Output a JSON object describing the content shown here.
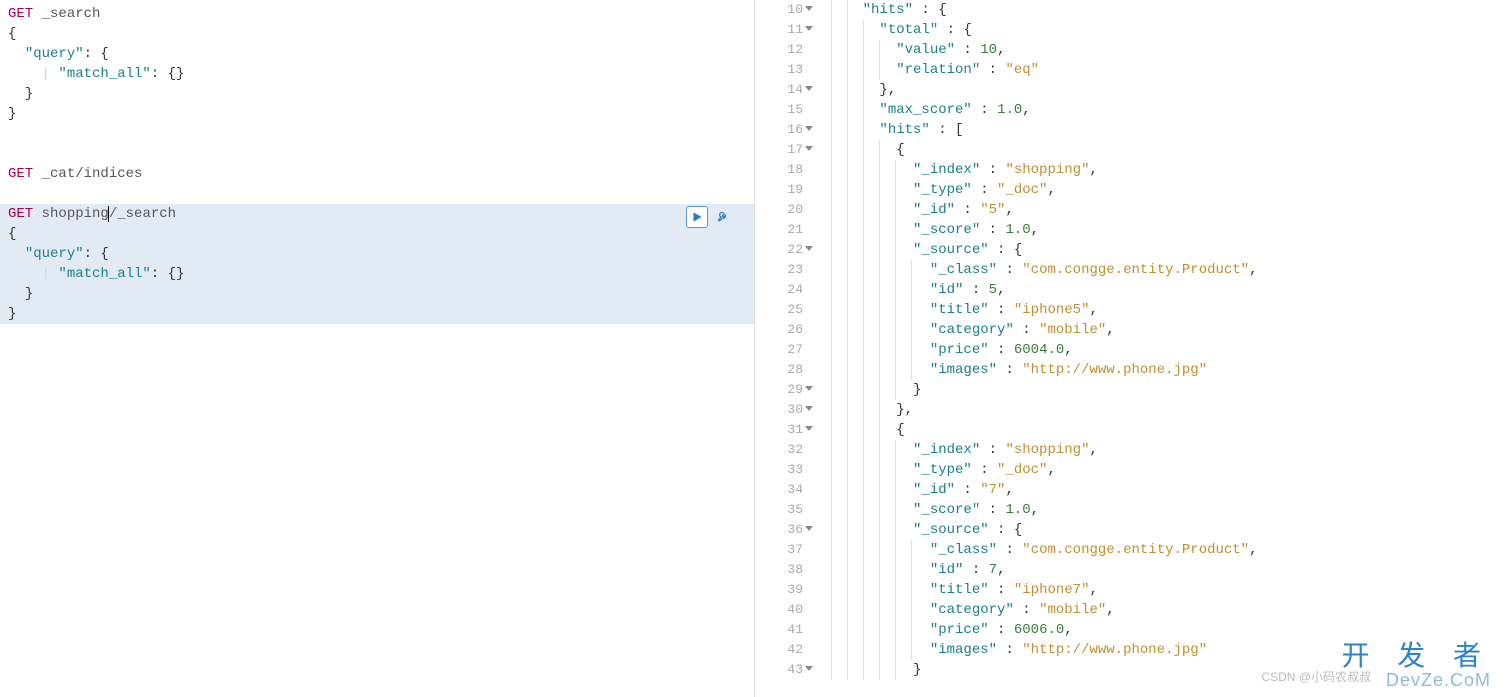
{
  "left": {
    "blocks": [
      {
        "active": false,
        "lines": [
          {
            "indent": 0,
            "tokens": [
              {
                "t": "method",
                "v": "GET"
              },
              {
                "t": "space",
                "v": " "
              },
              {
                "t": "path",
                "v": "_search"
              }
            ]
          },
          {
            "indent": 0,
            "tokens": [
              {
                "t": "punc",
                "v": "{"
              }
            ]
          },
          {
            "indent": 1,
            "tokens": [
              {
                "t": "key",
                "v": "\"query\""
              },
              {
                "t": "punc",
                "v": ": {"
              }
            ]
          },
          {
            "indent": 2,
            "tokens": [
              {
                "t": "key",
                "v": "\"match_all\""
              },
              {
                "t": "punc",
                "v": ": {}"
              }
            ]
          },
          {
            "indent": 1,
            "tokens": [
              {
                "t": "punc",
                "v": "}"
              }
            ]
          },
          {
            "indent": 0,
            "tokens": [
              {
                "t": "punc",
                "v": "}"
              }
            ]
          }
        ]
      },
      {
        "spacer": true,
        "lines": 2
      },
      {
        "active": false,
        "lines": [
          {
            "indent": 0,
            "tokens": [
              {
                "t": "method",
                "v": "GET"
              },
              {
                "t": "space",
                "v": " "
              },
              {
                "t": "path",
                "v": "_cat/indices"
              }
            ]
          }
        ]
      },
      {
        "spacer": true,
        "lines": 1
      },
      {
        "active": true,
        "lines": [
          {
            "indent": 0,
            "tokens": [
              {
                "t": "method",
                "v": "GET"
              },
              {
                "t": "space",
                "v": " "
              },
              {
                "t": "path",
                "v": "shopping"
              },
              {
                "t": "cursor",
                "v": ""
              },
              {
                "t": "path",
                "v": "/_search"
              }
            ]
          },
          {
            "indent": 0,
            "tokens": [
              {
                "t": "punc",
                "v": "{"
              }
            ]
          },
          {
            "indent": 1,
            "tokens": [
              {
                "t": "key",
                "v": "\"query\""
              },
              {
                "t": "punc",
                "v": ": {"
              }
            ]
          },
          {
            "indent": 2,
            "tokens": [
              {
                "t": "key",
                "v": "\"match_all\""
              },
              {
                "t": "punc",
                "v": ": {}"
              }
            ]
          },
          {
            "indent": 1,
            "tokens": [
              {
                "t": "punc",
                "v": "}"
              }
            ]
          },
          {
            "indent": 0,
            "tokens": [
              {
                "t": "punc",
                "v": "}"
              }
            ]
          }
        ]
      }
    ]
  },
  "right": {
    "startLine": 10,
    "lines": [
      {
        "n": 10,
        "fold": true,
        "depth": 2,
        "tokens": [
          {
            "t": "key",
            "v": "\"hits\""
          },
          {
            "t": "punc",
            "v": " : {"
          }
        ]
      },
      {
        "n": 11,
        "fold": true,
        "depth": 3,
        "tokens": [
          {
            "t": "key",
            "v": "\"total\""
          },
          {
            "t": "punc",
            "v": " : {"
          }
        ]
      },
      {
        "n": 12,
        "fold": false,
        "depth": 4,
        "tokens": [
          {
            "t": "key",
            "v": "\"value\""
          },
          {
            "t": "punc",
            "v": " : "
          },
          {
            "t": "num",
            "v": "10"
          },
          {
            "t": "punc",
            "v": ","
          }
        ]
      },
      {
        "n": 13,
        "fold": false,
        "depth": 4,
        "tokens": [
          {
            "t": "key",
            "v": "\"relation\""
          },
          {
            "t": "punc",
            "v": " : "
          },
          {
            "t": "str",
            "v": "\"eq\""
          }
        ]
      },
      {
        "n": 14,
        "fold": true,
        "depth": 3,
        "tokens": [
          {
            "t": "punc",
            "v": "},"
          }
        ]
      },
      {
        "n": 15,
        "fold": false,
        "depth": 3,
        "tokens": [
          {
            "t": "key",
            "v": "\"max_score\""
          },
          {
            "t": "punc",
            "v": " : "
          },
          {
            "t": "num",
            "v": "1.0"
          },
          {
            "t": "punc",
            "v": ","
          }
        ]
      },
      {
        "n": 16,
        "fold": true,
        "depth": 3,
        "tokens": [
          {
            "t": "key",
            "v": "\"hits\""
          },
          {
            "t": "punc",
            "v": " : ["
          }
        ]
      },
      {
        "n": 17,
        "fold": true,
        "depth": 4,
        "tokens": [
          {
            "t": "punc",
            "v": "{"
          }
        ]
      },
      {
        "n": 18,
        "fold": false,
        "depth": 5,
        "tokens": [
          {
            "t": "key",
            "v": "\"_index\""
          },
          {
            "t": "punc",
            "v": " : "
          },
          {
            "t": "str",
            "v": "\"shopping\""
          },
          {
            "t": "punc",
            "v": ","
          }
        ]
      },
      {
        "n": 19,
        "fold": false,
        "depth": 5,
        "tokens": [
          {
            "t": "key",
            "v": "\"_type\""
          },
          {
            "t": "punc",
            "v": " : "
          },
          {
            "t": "str",
            "v": "\"_doc\""
          },
          {
            "t": "punc",
            "v": ","
          }
        ]
      },
      {
        "n": 20,
        "fold": false,
        "depth": 5,
        "tokens": [
          {
            "t": "key",
            "v": "\"_id\""
          },
          {
            "t": "punc",
            "v": " : "
          },
          {
            "t": "str",
            "v": "\"5\""
          },
          {
            "t": "punc",
            "v": ","
          }
        ]
      },
      {
        "n": 21,
        "fold": false,
        "depth": 5,
        "tokens": [
          {
            "t": "key",
            "v": "\"_score\""
          },
          {
            "t": "punc",
            "v": " : "
          },
          {
            "t": "num",
            "v": "1.0"
          },
          {
            "t": "punc",
            "v": ","
          }
        ]
      },
      {
        "n": 22,
        "fold": true,
        "depth": 5,
        "tokens": [
          {
            "t": "key",
            "v": "\"_source\""
          },
          {
            "t": "punc",
            "v": " : {"
          }
        ]
      },
      {
        "n": 23,
        "fold": false,
        "depth": 6,
        "tokens": [
          {
            "t": "key",
            "v": "\"_class\""
          },
          {
            "t": "punc",
            "v": " : "
          },
          {
            "t": "str",
            "v": "\"com.congge.entity.Product\""
          },
          {
            "t": "punc",
            "v": ","
          }
        ]
      },
      {
        "n": 24,
        "fold": false,
        "depth": 6,
        "tokens": [
          {
            "t": "key",
            "v": "\"id\""
          },
          {
            "t": "punc",
            "v": " : "
          },
          {
            "t": "num",
            "v": "5"
          },
          {
            "t": "punc",
            "v": ","
          }
        ]
      },
      {
        "n": 25,
        "fold": false,
        "depth": 6,
        "tokens": [
          {
            "t": "key",
            "v": "\"title\""
          },
          {
            "t": "punc",
            "v": " : "
          },
          {
            "t": "str",
            "v": "\"iphone5\""
          },
          {
            "t": "punc",
            "v": ","
          }
        ]
      },
      {
        "n": 26,
        "fold": false,
        "depth": 6,
        "tokens": [
          {
            "t": "key",
            "v": "\"category\""
          },
          {
            "t": "punc",
            "v": " : "
          },
          {
            "t": "str",
            "v": "\"mobile\""
          },
          {
            "t": "punc",
            "v": ","
          }
        ]
      },
      {
        "n": 27,
        "fold": false,
        "depth": 6,
        "tokens": [
          {
            "t": "key",
            "v": "\"price\""
          },
          {
            "t": "punc",
            "v": " : "
          },
          {
            "t": "num",
            "v": "6004.0"
          },
          {
            "t": "punc",
            "v": ","
          }
        ]
      },
      {
        "n": 28,
        "fold": false,
        "depth": 6,
        "tokens": [
          {
            "t": "key",
            "v": "\"images\""
          },
          {
            "t": "punc",
            "v": " : "
          },
          {
            "t": "str",
            "v": "\"http://www.phone.jpg\""
          }
        ]
      },
      {
        "n": 29,
        "fold": true,
        "depth": 5,
        "tokens": [
          {
            "t": "punc",
            "v": "}"
          }
        ]
      },
      {
        "n": 30,
        "fold": true,
        "depth": 4,
        "tokens": [
          {
            "t": "punc",
            "v": "},"
          }
        ]
      },
      {
        "n": 31,
        "fold": true,
        "depth": 4,
        "tokens": [
          {
            "t": "punc",
            "v": "{"
          }
        ]
      },
      {
        "n": 32,
        "fold": false,
        "depth": 5,
        "tokens": [
          {
            "t": "key",
            "v": "\"_index\""
          },
          {
            "t": "punc",
            "v": " : "
          },
          {
            "t": "str",
            "v": "\"shopping\""
          },
          {
            "t": "punc",
            "v": ","
          }
        ]
      },
      {
        "n": 33,
        "fold": false,
        "depth": 5,
        "tokens": [
          {
            "t": "key",
            "v": "\"_type\""
          },
          {
            "t": "punc",
            "v": " : "
          },
          {
            "t": "str",
            "v": "\"_doc\""
          },
          {
            "t": "punc",
            "v": ","
          }
        ]
      },
      {
        "n": 34,
        "fold": false,
        "depth": 5,
        "tokens": [
          {
            "t": "key",
            "v": "\"_id\""
          },
          {
            "t": "punc",
            "v": " : "
          },
          {
            "t": "str",
            "v": "\"7\""
          },
          {
            "t": "punc",
            "v": ","
          }
        ]
      },
      {
        "n": 35,
        "fold": false,
        "depth": 5,
        "tokens": [
          {
            "t": "key",
            "v": "\"_score\""
          },
          {
            "t": "punc",
            "v": " : "
          },
          {
            "t": "num",
            "v": "1.0"
          },
          {
            "t": "punc",
            "v": ","
          }
        ]
      },
      {
        "n": 36,
        "fold": true,
        "depth": 5,
        "tokens": [
          {
            "t": "key",
            "v": "\"_source\""
          },
          {
            "t": "punc",
            "v": " : {"
          }
        ]
      },
      {
        "n": 37,
        "fold": false,
        "depth": 6,
        "tokens": [
          {
            "t": "key",
            "v": "\"_class\""
          },
          {
            "t": "punc",
            "v": " : "
          },
          {
            "t": "str",
            "v": "\"com.congge.entity.Product\""
          },
          {
            "t": "punc",
            "v": ","
          }
        ]
      },
      {
        "n": 38,
        "fold": false,
        "depth": 6,
        "tokens": [
          {
            "t": "key",
            "v": "\"id\""
          },
          {
            "t": "punc",
            "v": " : "
          },
          {
            "t": "num",
            "v": "7"
          },
          {
            "t": "punc",
            "v": ","
          }
        ]
      },
      {
        "n": 39,
        "fold": false,
        "depth": 6,
        "tokens": [
          {
            "t": "key",
            "v": "\"title\""
          },
          {
            "t": "punc",
            "v": " : "
          },
          {
            "t": "str",
            "v": "\"iphone7\""
          },
          {
            "t": "punc",
            "v": ","
          }
        ]
      },
      {
        "n": 40,
        "fold": false,
        "depth": 6,
        "tokens": [
          {
            "t": "key",
            "v": "\"category\""
          },
          {
            "t": "punc",
            "v": " : "
          },
          {
            "t": "str",
            "v": "\"mobile\""
          },
          {
            "t": "punc",
            "v": ","
          }
        ]
      },
      {
        "n": 41,
        "fold": false,
        "depth": 6,
        "tokens": [
          {
            "t": "key",
            "v": "\"price\""
          },
          {
            "t": "punc",
            "v": " : "
          },
          {
            "t": "num",
            "v": "6006.0"
          },
          {
            "t": "punc",
            "v": ","
          }
        ]
      },
      {
        "n": 42,
        "fold": false,
        "depth": 6,
        "tokens": [
          {
            "t": "key",
            "v": "\"images\""
          },
          {
            "t": "punc",
            "v": " : "
          },
          {
            "t": "str",
            "v": "\"http://www.phone.jpg\""
          }
        ]
      },
      {
        "n": 43,
        "fold": true,
        "depth": 5,
        "tokens": [
          {
            "t": "punc",
            "v": "}"
          }
        ]
      }
    ]
  },
  "watermark": {
    "cn": "开 发 者",
    "en": "DevZe.CoM",
    "csdn": "CSDN @小码农叔叔"
  },
  "actions": {
    "run_title": "Click to send request",
    "wrench_title": "Open documentation"
  }
}
